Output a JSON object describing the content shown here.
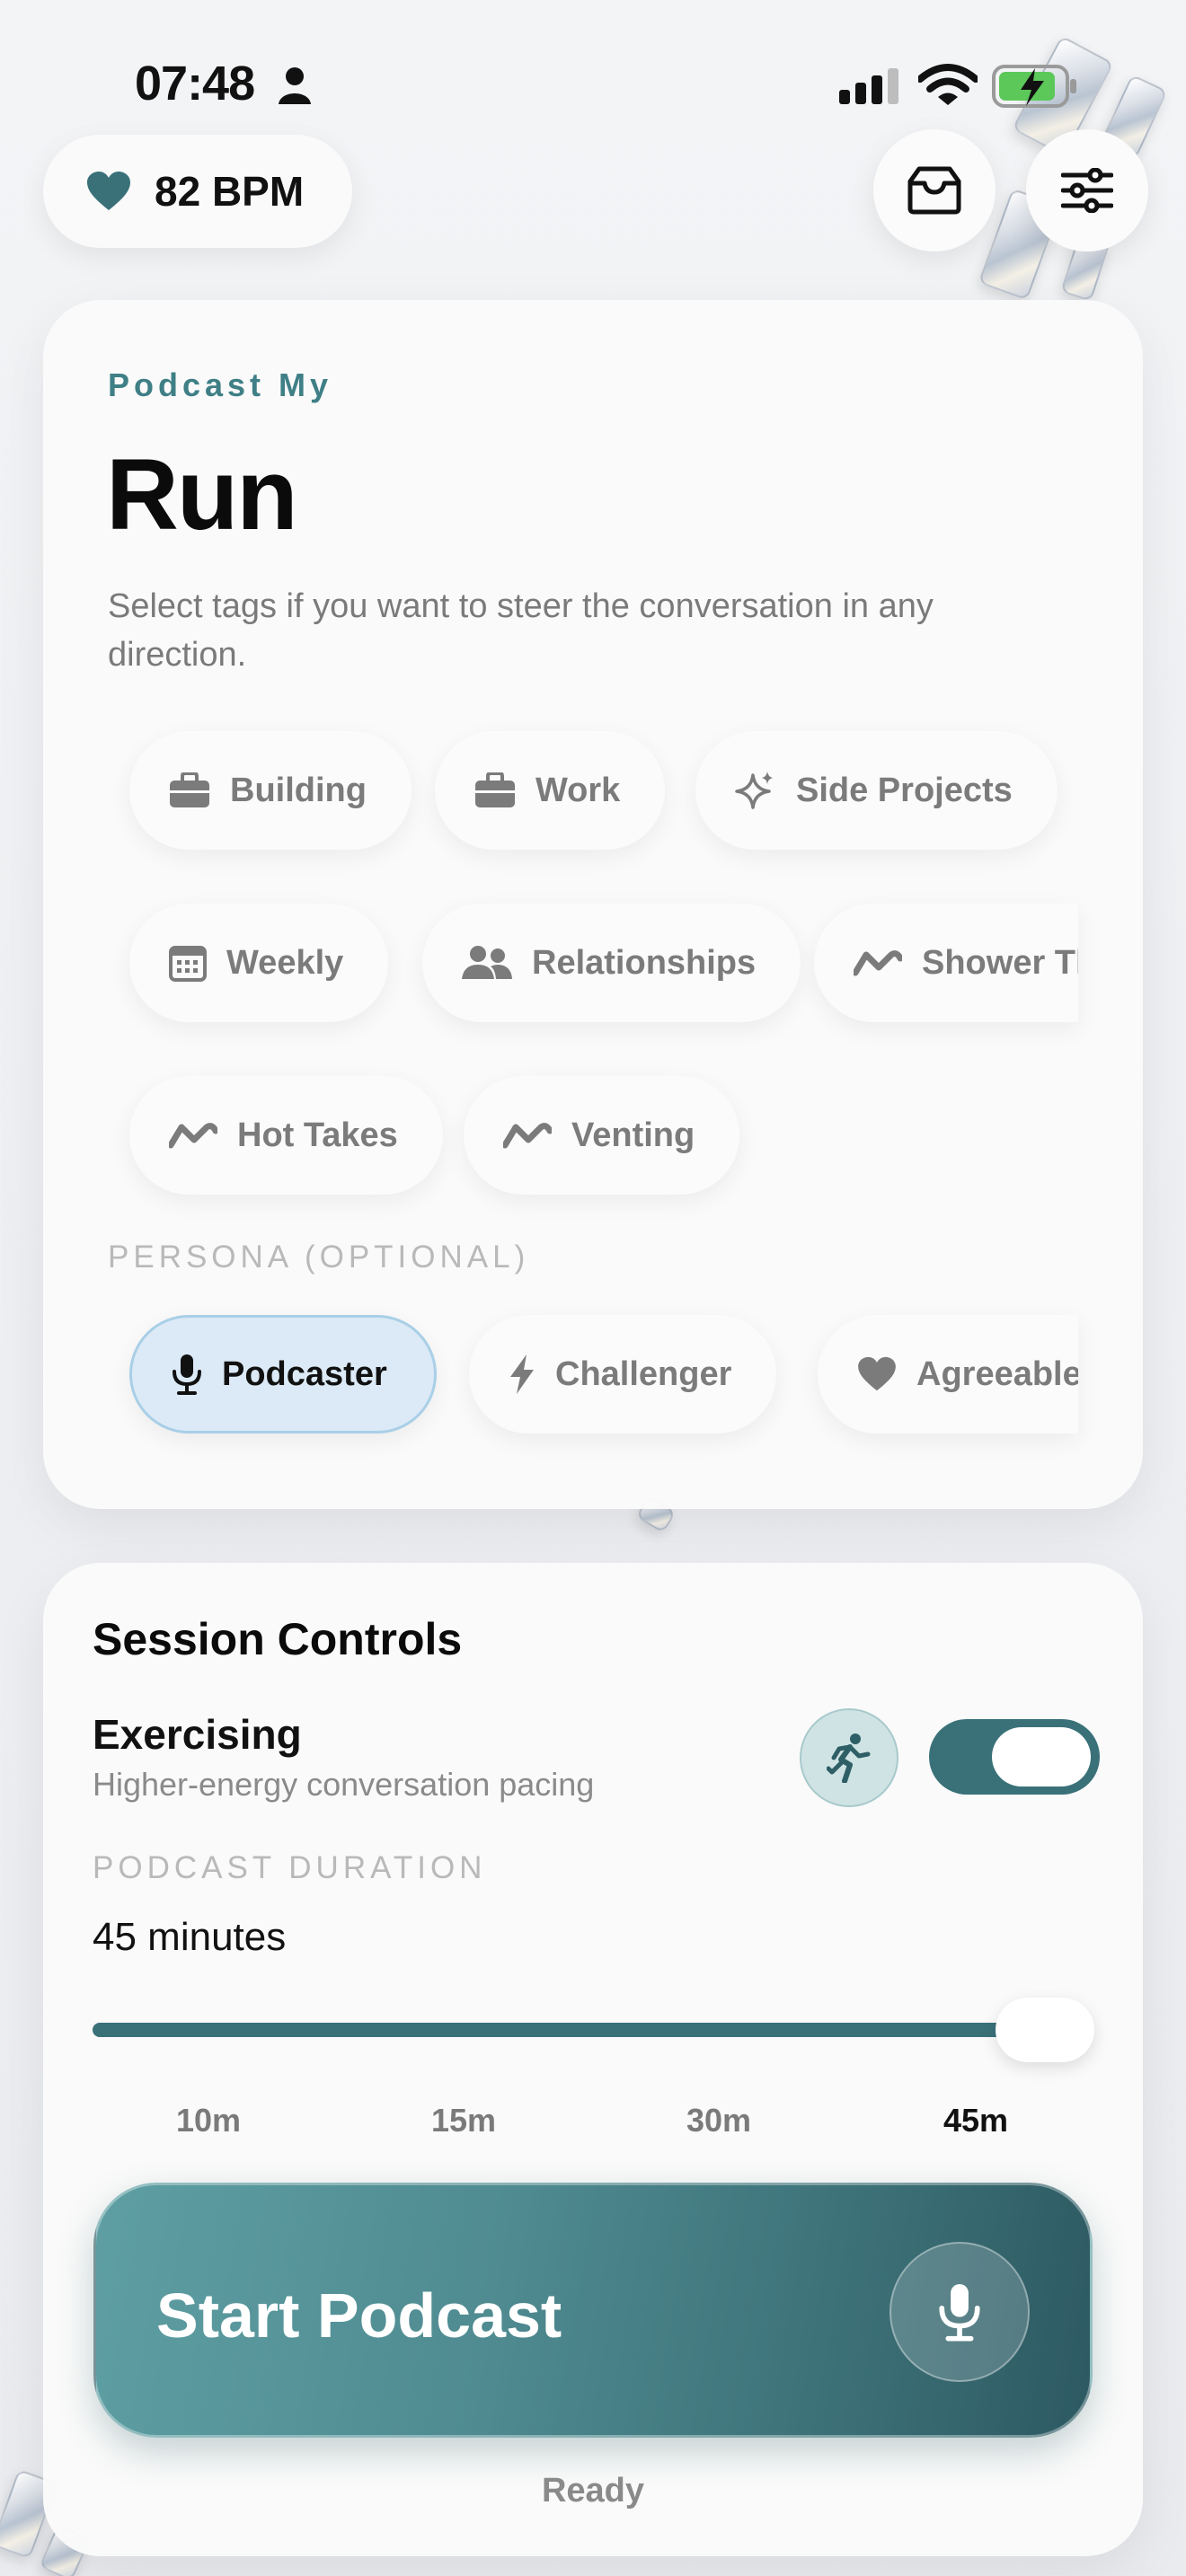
{
  "status_bar": {
    "time": "07:48"
  },
  "heart_rate": {
    "value": "82 BPM"
  },
  "header": {
    "inbox_icon": "tray-icon",
    "settings_icon": "sliders-icon"
  },
  "main_card": {
    "eyebrow": "Podcast My",
    "title": "Run",
    "description": "Select tags if you want to steer the conversation in any direction.",
    "tags": [
      {
        "label": "Building",
        "icon": "briefcase-icon"
      },
      {
        "label": "Work",
        "icon": "briefcase-icon"
      },
      {
        "label": "Side Projects",
        "icon": "sparkles-icon"
      },
      {
        "label": "Weekly",
        "icon": "calendar-icon"
      },
      {
        "label": "Relationships",
        "icon": "people-icon"
      },
      {
        "label": "Shower Th",
        "icon": "squiggle-icon"
      },
      {
        "label": "Hot Takes",
        "icon": "squiggle-icon"
      },
      {
        "label": "Venting",
        "icon": "squiggle-icon"
      }
    ],
    "persona_label": "PERSONA (OPTIONAL)",
    "personas": [
      {
        "label": "Podcaster",
        "icon": "mic-icon",
        "selected": true
      },
      {
        "label": "Challenger",
        "icon": "bolt-icon",
        "selected": false
      },
      {
        "label": "Agreeable",
        "icon": "heart-icon",
        "selected": false
      }
    ]
  },
  "session": {
    "title": "Session Controls",
    "exercising_title": "Exercising",
    "exercising_sub": "Higher-energy conversation pacing",
    "exercising_on": true,
    "duration_label": "PODCAST DURATION",
    "duration_value": "45 minutes",
    "duration_ticks": [
      "10m",
      "15m",
      "30m",
      "45m"
    ],
    "duration_selected_index": 3,
    "start_label": "Start Podcast",
    "status": "Ready"
  },
  "colors": {
    "accent": "#3a7179",
    "eyebrow": "#3f7f86",
    "persona_selected_bg": "#dbeaf6"
  }
}
